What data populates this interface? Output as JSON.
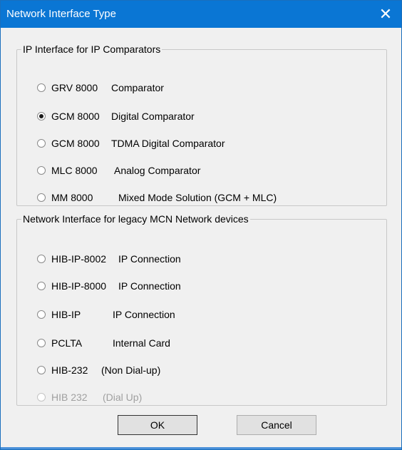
{
  "window": {
    "title": "Network Interface Type",
    "close_glyph": "✕"
  },
  "group_ip": {
    "legend": "IP Interface for IP Comparators",
    "options": [
      {
        "model": "GRV 8000",
        "desc": "Comparator",
        "checked": false
      },
      {
        "model": "GCM 8000",
        "desc": "Digital Comparator",
        "checked": true
      },
      {
        "model": "GCM 8000",
        "desc": "TDMA Digital Comparator",
        "checked": false
      },
      {
        "model": "MLC 8000",
        "desc": "Analog Comparator",
        "checked": false
      },
      {
        "model": "MM 8000",
        "desc": "Mixed Mode Solution (GCM + MLC)",
        "checked": false
      }
    ]
  },
  "group_legacy": {
    "legend": "Network Interface for legacy MCN Network devices",
    "options": [
      {
        "model": "HIB-IP-8002",
        "desc": "IP Connection",
        "checked": false,
        "disabled": false
      },
      {
        "model": "HIB-IP-8000",
        "desc": "IP Connection",
        "checked": false,
        "disabled": false
      },
      {
        "model": "HIB-IP",
        "desc": "IP Connection",
        "checked": false,
        "disabled": false
      },
      {
        "model": "PCLTA",
        "desc": "Internal Card",
        "checked": false,
        "disabled": false
      },
      {
        "model": "HIB-232",
        "desc": "(Non Dial-up)",
        "checked": false,
        "disabled": false
      },
      {
        "model": "HIB 232",
        "desc": "(Dial Up)",
        "checked": false,
        "disabled": true
      }
    ]
  },
  "buttons": {
    "ok": "OK",
    "cancel": "Cancel"
  },
  "colors": {
    "titlebar": "#0a76d4",
    "dialog_bg": "#f0f0f0",
    "disabled_text": "#a0a0a0"
  }
}
